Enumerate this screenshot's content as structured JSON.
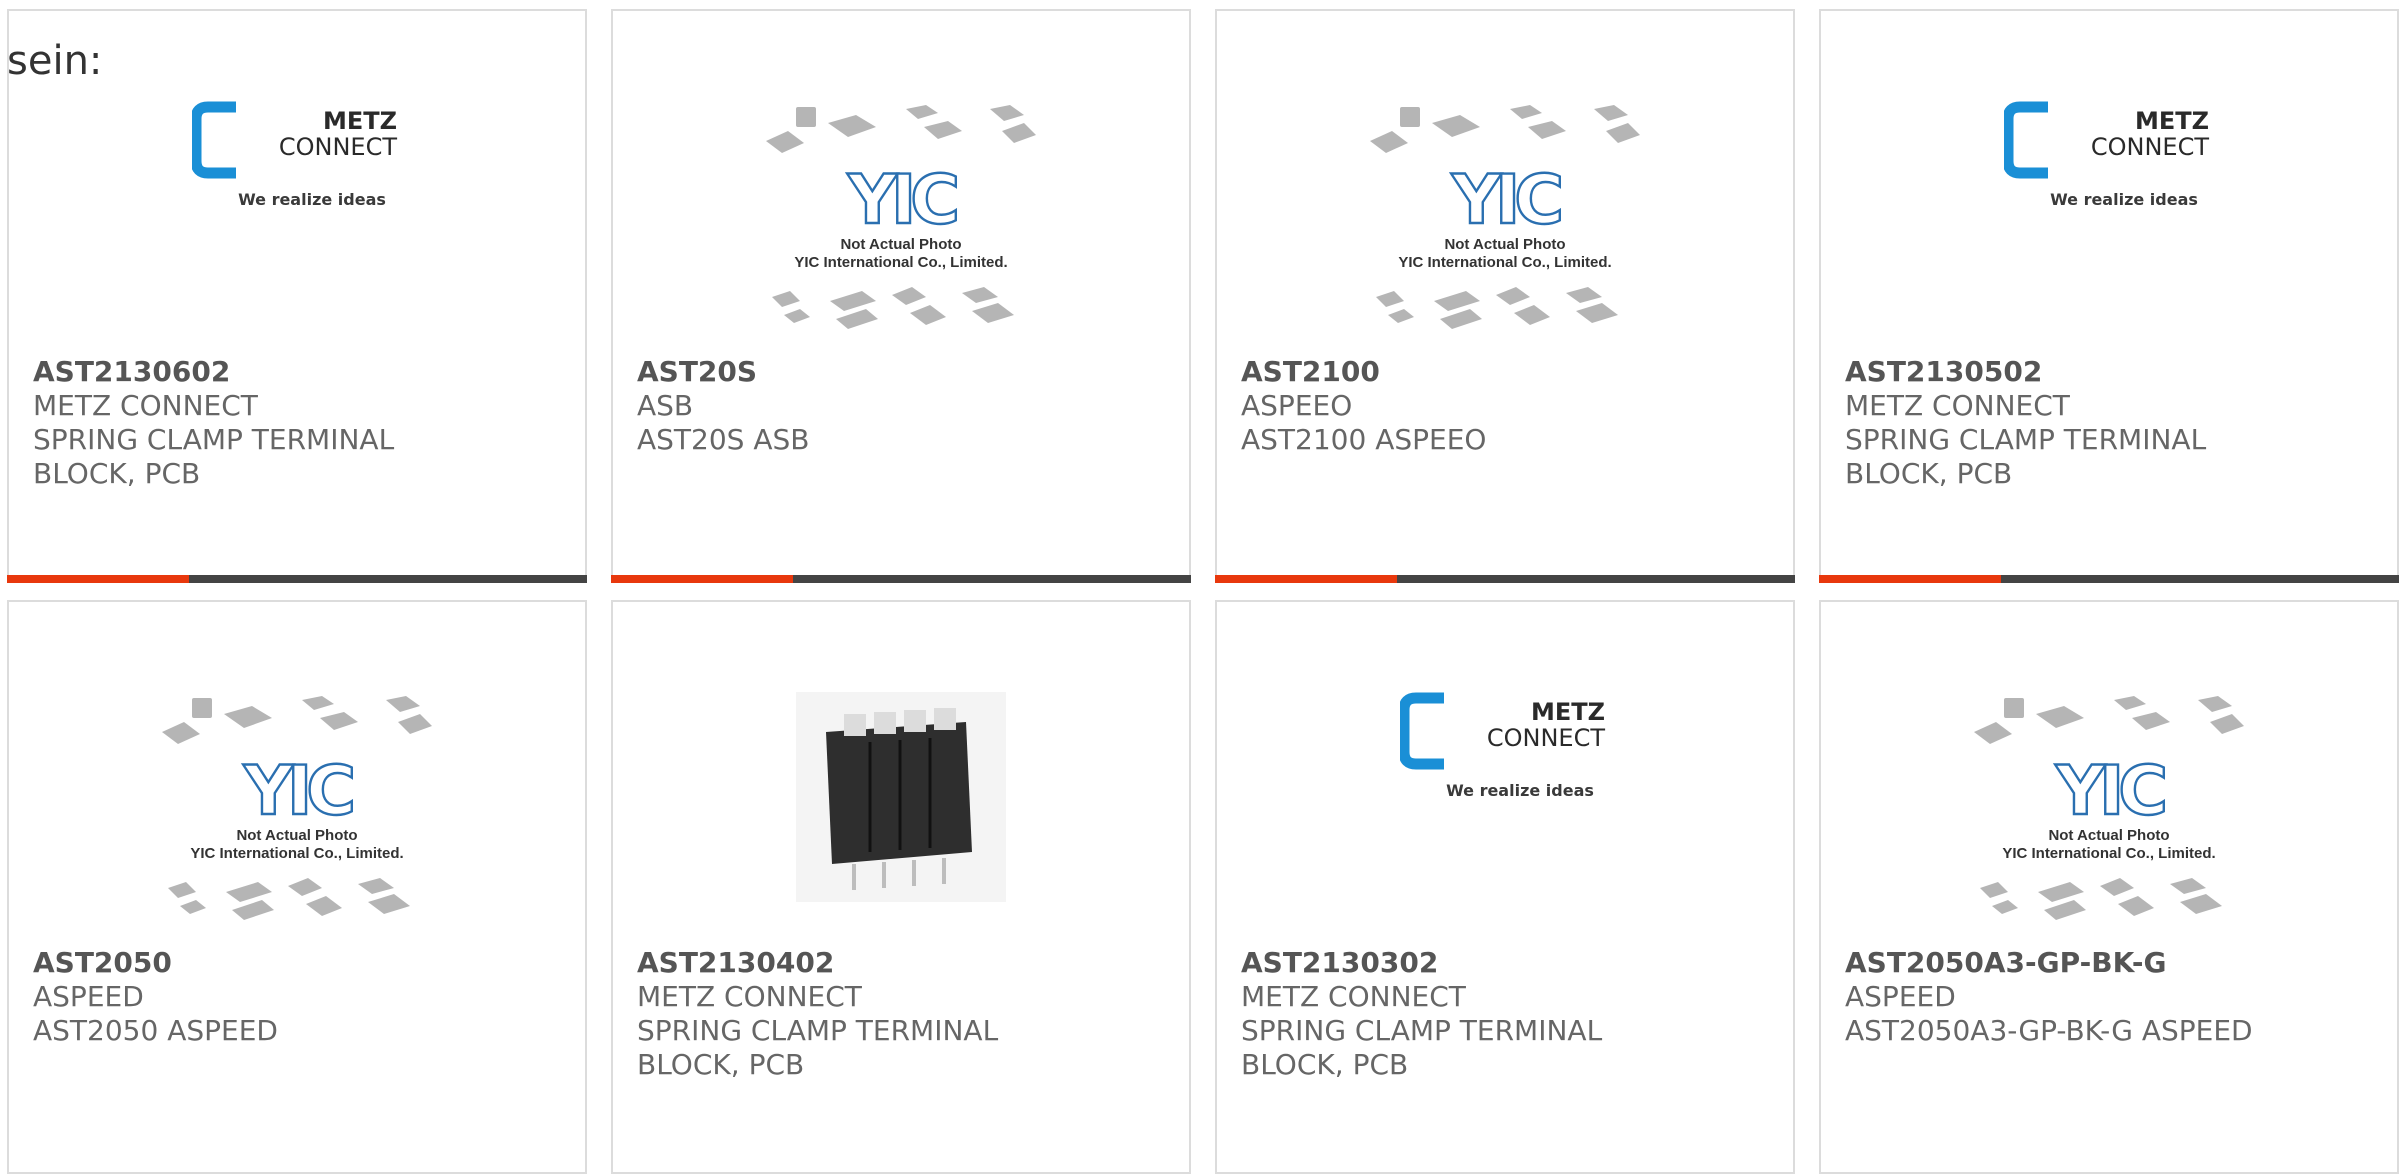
{
  "intro_text": "sein:",
  "colors": {
    "accent": "#e8380d",
    "bar": "#444444",
    "metz_blue": "#1a8fd6"
  },
  "products": [
    {
      "part": "AST2130602",
      "brand": "METZ CONNECT",
      "desc1": "SPRING CLAMP TERMINAL",
      "desc2": "BLOCK, PCB",
      "image": "metz-logo"
    },
    {
      "part": "AST20S",
      "brand": "ASB",
      "desc1": "AST20S ASB",
      "desc2": "",
      "image": "yic-placeholder"
    },
    {
      "part": "AST2100",
      "brand": "ASPEEO",
      "desc1": "AST2100 ASPEEO",
      "desc2": "",
      "image": "yic-placeholder"
    },
    {
      "part": "AST2130502",
      "brand": "METZ CONNECT",
      "desc1": "SPRING CLAMP TERMINAL",
      "desc2": "BLOCK, PCB",
      "image": "metz-logo"
    },
    {
      "part": "AST2050",
      "brand": "ASPEED",
      "desc1": "AST2050 ASPEED",
      "desc2": "",
      "image": "yic-placeholder"
    },
    {
      "part": "AST2130402",
      "brand": "METZ CONNECT",
      "desc1": "SPRING CLAMP TERMINAL",
      "desc2": "BLOCK, PCB",
      "image": "terminal-block-photo"
    },
    {
      "part": "AST2130302",
      "brand": "METZ CONNECT",
      "desc1": "SPRING CLAMP TERMINAL",
      "desc2": "BLOCK, PCB",
      "image": "metz-logo"
    },
    {
      "part": "AST2050A3-GP-BK-G",
      "brand": "ASPEED",
      "desc1": "AST2050A3-GP-BK-G ASPEED",
      "desc2": "",
      "image": "yic-placeholder"
    }
  ],
  "metz_logo": {
    "line1": "METZ",
    "line2": "CONNECT",
    "tagline": "We realize ideas"
  },
  "yic_placeholder": {
    "logo": "YIC",
    "line1": "Not Actual Photo",
    "line2": "YIC International Co., Limited."
  }
}
